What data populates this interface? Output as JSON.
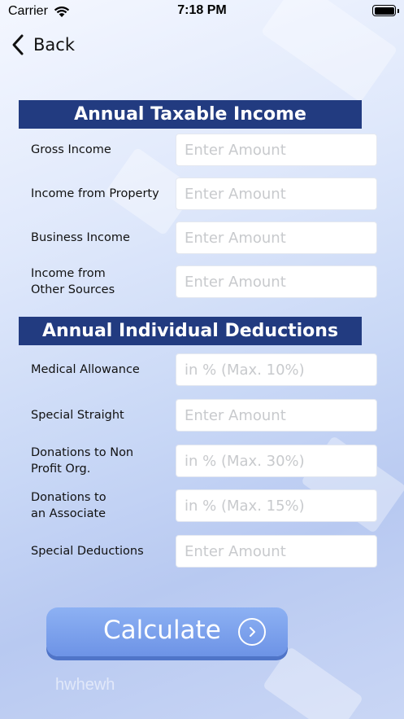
{
  "status_bar": {
    "carrier": "Carrier",
    "time": "7:18 PM"
  },
  "nav": {
    "back_label": "Back"
  },
  "taxable_income": {
    "title": "Annual Taxable Income",
    "fields": [
      {
        "label": "Gross Income",
        "placeholder": "Enter Amount",
        "value": ""
      },
      {
        "label": "Income from Property",
        "placeholder": "Enter Amount",
        "value": ""
      },
      {
        "label": "Business Income",
        "placeholder": "Enter Amount",
        "value": ""
      },
      {
        "label": "Income from\nOther Sources",
        "placeholder": "Enter Amount",
        "value": ""
      }
    ]
  },
  "deductions": {
    "title": "Annual Individual Deductions",
    "fields": [
      {
        "label": "Medical Allowance",
        "placeholder": "in % (Max. 10%)",
        "value": ""
      },
      {
        "label": "Special Straight",
        "placeholder": "Enter Amount",
        "value": ""
      },
      {
        "label": "Donations to Non\nProfit Org.",
        "placeholder": "in % (Max. 30%)",
        "value": ""
      },
      {
        "label": "Donations to\nan Associate",
        "placeholder": "in % (Max. 15%)",
        "value": ""
      },
      {
        "label": "Special Deductions",
        "placeholder": "Enter Amount",
        "value": ""
      }
    ]
  },
  "calculate_button": {
    "label": "Calculate",
    "icon": "chevron-right-circle-icon"
  },
  "watermark": "hwhewh",
  "colors": {
    "header_bg": "#223b80",
    "button_bg": "#7a9fec",
    "background": "#c9d8f6"
  }
}
